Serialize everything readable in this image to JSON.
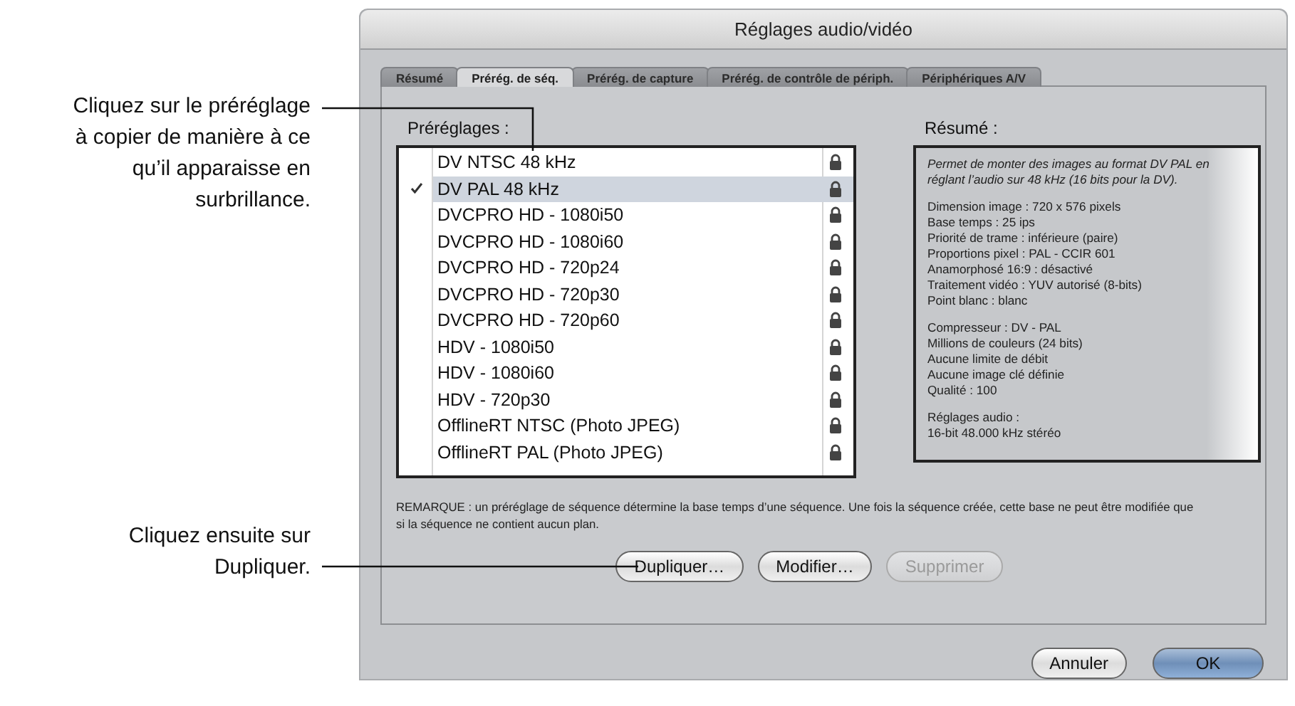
{
  "callouts": [
    {
      "text": "Cliquez sur le préréglage à copier de manière à ce qu’il apparaisse en surbrillance."
    },
    {
      "text": "Cliquez ensuite sur Dupliquer."
    }
  ],
  "window": {
    "title": "Réglages audio/vidéo"
  },
  "tabs": [
    {
      "label": "Résumé",
      "selected": false
    },
    {
      "label": "Prérég. de séq.",
      "selected": true
    },
    {
      "label": "Prérég. de capture",
      "selected": false
    },
    {
      "label": "Prérég. de contrôle de périph.",
      "selected": false
    },
    {
      "label": "Périphériques A/V",
      "selected": false
    }
  ],
  "presets": {
    "label": "Préréglages :",
    "items": [
      {
        "name": "DV NTSC 48 kHz",
        "checked": false,
        "selected": false,
        "locked": true
      },
      {
        "name": "DV PAL 48 kHz",
        "checked": true,
        "selected": true,
        "locked": true
      },
      {
        "name": "DVCPRO HD - 1080i50",
        "checked": false,
        "selected": false,
        "locked": true
      },
      {
        "name": "DVCPRO HD - 1080i60",
        "checked": false,
        "selected": false,
        "locked": true
      },
      {
        "name": "DVCPRO HD - 720p24",
        "checked": false,
        "selected": false,
        "locked": true
      },
      {
        "name": "DVCPRO HD - 720p30",
        "checked": false,
        "selected": false,
        "locked": true
      },
      {
        "name": "DVCPRO HD - 720p60",
        "checked": false,
        "selected": false,
        "locked": true
      },
      {
        "name": "HDV - 1080i50",
        "checked": false,
        "selected": false,
        "locked": true
      },
      {
        "name": "HDV - 1080i60",
        "checked": false,
        "selected": false,
        "locked": true
      },
      {
        "name": "HDV - 720p30",
        "checked": false,
        "selected": false,
        "locked": true
      },
      {
        "name": "OfflineRT NTSC (Photo JPEG)",
        "checked": false,
        "selected": false,
        "locked": true
      },
      {
        "name": "OfflineRT PAL (Photo JPEG)",
        "checked": false,
        "selected": false,
        "locked": true
      }
    ]
  },
  "summary": {
    "label": "Résumé :",
    "description": "Permet de monter des images au format DV PAL en réglant l’audio sur 48 kHz (16 bits pour la DV).",
    "sections": [
      [
        "Dimension image : 720 x 576 pixels",
        "Base temps : 25 ips",
        "Priorité de trame : inférieure (paire)",
        "Proportions pixel : PAL - CCIR 601",
        "Anamorphosé 16:9 : désactivé",
        "Traitement vidéo : YUV autorisé (8-bits)",
        "Point blanc : blanc"
      ],
      [
        "Compresseur : DV - PAL",
        "Millions de couleurs (24 bits)",
        "Aucune limite de débit",
        "Aucune image clé définie",
        "Qualité : 100"
      ],
      [
        "Réglages audio :",
        "16-bit 48.000 kHz stéréo"
      ]
    ]
  },
  "note": "REMARQUE : un préréglage de séquence détermine la base temps d’une séquence. Une fois la séquence créée, cette base ne peut être modifiée que si la séquence ne contient aucun plan.",
  "actions": [
    {
      "label": "Dupliquer…",
      "disabled": false
    },
    {
      "label": "Modifier…",
      "disabled": false
    },
    {
      "label": "Supprimer",
      "disabled": true
    }
  ],
  "footer_buttons": [
    {
      "label": "Annuler",
      "default": false
    },
    {
      "label": "OK",
      "default": true
    }
  ]
}
